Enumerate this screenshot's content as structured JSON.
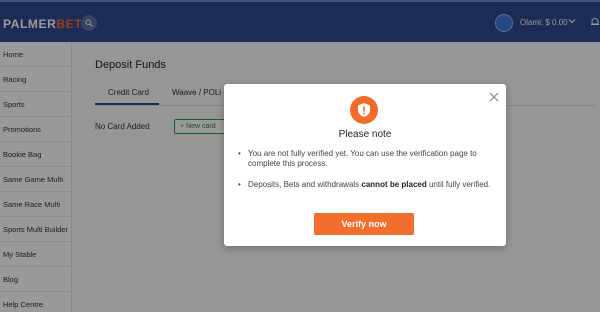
{
  "header": {
    "brand_left": "PALMER",
    "brand_right": "BET",
    "account_text": "Olami: $ 0.00",
    "icons": [
      "search-icon",
      "avatar",
      "chevron-down-icon",
      "bell-icon"
    ]
  },
  "sidebar": {
    "items": [
      {
        "label": "Home"
      },
      {
        "label": "Racing"
      },
      {
        "label": "Sports"
      },
      {
        "label": "Promotions"
      },
      {
        "label": "Bookie Bag"
      },
      {
        "label": "Same Game Multi"
      },
      {
        "label": "Same Race Multi"
      },
      {
        "label": "Sports Multi Builder"
      },
      {
        "label": "My Stable"
      },
      {
        "label": "Blog"
      },
      {
        "label": "Help Centre"
      }
    ]
  },
  "main": {
    "title": "Deposit Funds",
    "tabs": [
      {
        "label": "Credit Card"
      },
      {
        "label": "Waave / POLi"
      }
    ],
    "no_card_text": "No Card Added",
    "new_card_label": "+ New card"
  },
  "modal": {
    "title": "Please note",
    "bullet_symbol": "•",
    "bullet_1": "You are not fully verified yet. You can use the verification page to complete this process.",
    "bullet_2_pre": "Deposits, Bets and withdrawals ",
    "bullet_2_bold": "cannot be placed",
    "bullet_2_post": " until fully verified.",
    "verify_label": "Verify now",
    "icons": [
      "shield-alert-icon",
      "close-icon"
    ]
  },
  "colors": {
    "header_bg": "#2f4a8f",
    "brand_accent": "#ff6a2a",
    "button_orange": "#f36d2d",
    "new_card_green": "#2e9c4b"
  }
}
